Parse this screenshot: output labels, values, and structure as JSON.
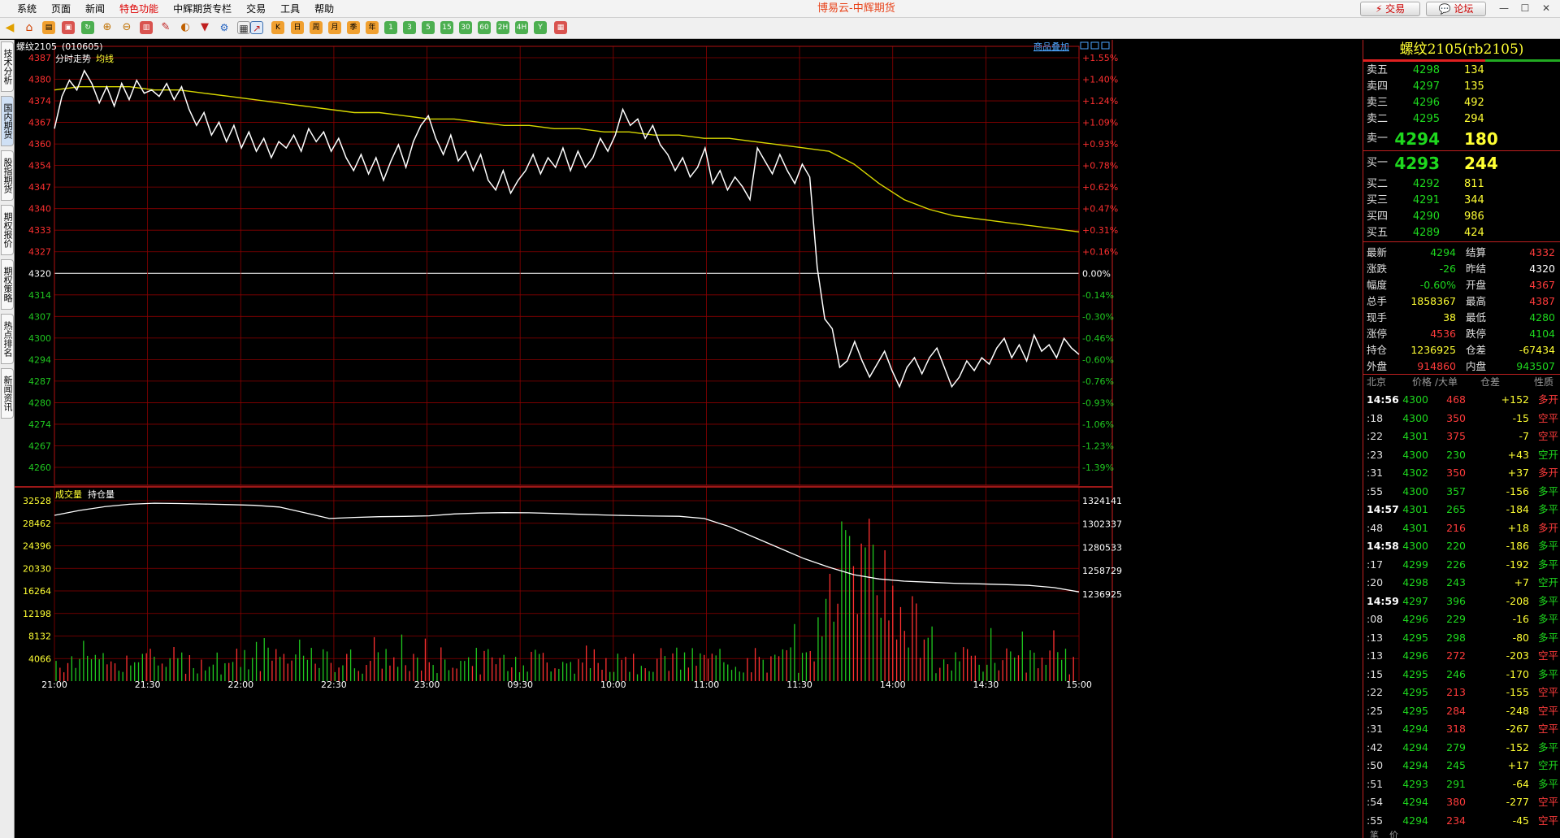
{
  "menu": {
    "items": [
      "系统",
      "页面",
      "新闻",
      "特色功能",
      "中辉期货专栏",
      "交易",
      "工具",
      "帮助"
    ],
    "highlight_index": 3
  },
  "app_title": "博易云-中辉期货",
  "top_buttons": {
    "trade": "交易",
    "forum": "论坛"
  },
  "toolbar": {
    "period_buttons": [
      "日",
      "周",
      "月",
      "季",
      "年",
      "1",
      "3",
      "5",
      "15",
      "30",
      "60",
      "2H",
      "4H",
      "Y"
    ],
    "period_icons": [
      "day-period-icon",
      "week-period-icon",
      "month-period-icon",
      "quarter-period-icon",
      "year-period-icon",
      "1min-icon",
      "3min-icon",
      "5min-icon",
      "15min-icon",
      "30min-icon",
      "60min-icon",
      "2hour-icon",
      "4hour-icon",
      "y-icon"
    ]
  },
  "left_tabs": [
    "技术分析",
    "国内期货",
    "股指期货",
    "期权报价",
    "期权策略",
    "热点排名",
    "新闻资讯"
  ],
  "chart_header": {
    "contract": "螺纹2105",
    "code": "(010605)",
    "tab_trend": "分时走势",
    "tab_avg": "均线",
    "overlay_link": "商品叠加",
    "vol_label": "成交量",
    "oi_label": "持仓量"
  },
  "chart_data": [
    {
      "type": "line",
      "title": "分时走势",
      "ylim": [
        4260,
        4387
      ],
      "y_ticks": [
        4387,
        4380,
        4374,
        4367,
        4360,
        4354,
        4347,
        4340,
        4333,
        4327,
        4320,
        4314,
        4307,
        4300,
        4294,
        4287,
        4280,
        4274,
        4267,
        4260
      ],
      "pct_ticks": [
        "+1.55%",
        "+1.40%",
        "+1.24%",
        "+1.09%",
        "+0.93%",
        "+0.78%",
        "+0.62%",
        "+0.47%",
        "+0.31%",
        "+0.16%",
        "0.00%",
        "-0.14%",
        "-0.30%",
        "-0.46%",
        "-0.60%",
        "-0.76%",
        "-0.93%",
        "-1.06%",
        "-1.23%",
        "-1.39%"
      ],
      "x_ticks": [
        "21:00",
        "21:30",
        "22:00",
        "22:30",
        "23:00",
        "09:30",
        "10:00",
        "11:00",
        "11:30",
        "14:00",
        "14:30",
        "15:00"
      ],
      "series": [
        {
          "name": "分时走势",
          "color": "#ffffff",
          "values": [
            4365,
            4375,
            4380,
            4377,
            4383,
            4379,
            4373,
            4378,
            4372,
            4379,
            4374,
            4380,
            4376,
            4377,
            4375,
            4379,
            4374,
            4378,
            4371,
            4366,
            4370,
            4363,
            4367,
            4361,
            4366,
            4359,
            4364,
            4358,
            4362,
            4356,
            4361,
            4359,
            4363,
            4358,
            4365,
            4361,
            4364,
            4358,
            4362,
            4356,
            4352,
            4357,
            4351,
            4356,
            4349,
            4355,
            4360,
            4353,
            4361,
            4366,
            4369,
            4362,
            4357,
            4363,
            4355,
            4358,
            4352,
            4357,
            4349,
            4346,
            4352,
            4345,
            4349,
            4352,
            4357,
            4351,
            4356,
            4353,
            4359,
            4352,
            4358,
            4353,
            4356,
            4362,
            4358,
            4363,
            4371,
            4366,
            4368,
            4362,
            4366,
            4360,
            4357,
            4352,
            4356,
            4350,
            4353,
            4359,
            4348,
            4352,
            4346,
            4350,
            4347,
            4343,
            4359,
            4355,
            4351,
            4357,
            4352,
            4348,
            4354,
            4350,
            4322,
            4306,
            4303,
            4291,
            4293,
            4299,
            4293,
            4288,
            4292,
            4296,
            4290,
            4285,
            4291,
            4294,
            4289,
            4294,
            4297,
            4291,
            4285,
            4288,
            4293,
            4290,
            4294,
            4292,
            4297,
            4300,
            4294,
            4298,
            4293,
            4301,
            4296,
            4298,
            4294,
            4300,
            4297,
            4295
          ]
        },
        {
          "name": "均线",
          "color": "#d8d800",
          "values": [
            4377,
            4378,
            4378,
            4378,
            4377,
            4377,
            4376,
            4375,
            4374,
            4373,
            4372,
            4371,
            4370,
            4370,
            4369,
            4368,
            4368,
            4367,
            4366,
            4366,
            4365,
            4365,
            4364,
            4364,
            4363,
            4363,
            4362,
            4362,
            4361,
            4360,
            4359,
            4358,
            4354,
            4348,
            4343,
            4340,
            4338,
            4337,
            4336,
            4335,
            4334,
            4333
          ]
        }
      ]
    },
    {
      "type": "bar",
      "title": "成交量",
      "ylim": [
        0,
        32528
      ],
      "y_ticks": [
        32528,
        28462,
        24396,
        20330,
        16264,
        12198,
        8132,
        4066
      ],
      "oi_ticks": [
        1324141,
        1302337,
        1280533,
        1258729,
        1236925
      ],
      "series": [
        {
          "name": "成交量",
          "up_color": "#ff3030",
          "down_color": "#20c820"
        },
        {
          "name": "持仓量",
          "color": "#ffffff",
          "values": [
            1310500,
            1315000,
            1318500,
            1320800,
            1321800,
            1321500,
            1321000,
            1320500,
            1319800,
            1318200,
            1313000,
            1307500,
            1308500,
            1309200,
            1309500,
            1310000,
            1311800,
            1312600,
            1313000,
            1312800,
            1312200,
            1311500,
            1310800,
            1310200,
            1309800,
            1309600,
            1307500,
            1300000,
            1290000,
            1280000,
            1270000,
            1262000,
            1255000,
            1251000,
            1249000,
            1248000,
            1247000,
            1246500,
            1245800,
            1245000,
            1243000,
            1239000
          ]
        }
      ]
    }
  ],
  "quote": {
    "title": "螺纹2105(rb2105)",
    "asks": [
      {
        "label": "卖五",
        "price": "4298",
        "vol": "134"
      },
      {
        "label": "卖四",
        "price": "4297",
        "vol": "135"
      },
      {
        "label": "卖三",
        "price": "4296",
        "vol": "492"
      },
      {
        "label": "卖二",
        "price": "4295",
        "vol": "294"
      },
      {
        "label": "卖一",
        "price": "4294",
        "vol": "180"
      }
    ],
    "bids": [
      {
        "label": "买一",
        "price": "4293",
        "vol": "244"
      },
      {
        "label": "买二",
        "price": "4292",
        "vol": "811"
      },
      {
        "label": "买三",
        "price": "4291",
        "vol": "344"
      },
      {
        "label": "买四",
        "price": "4290",
        "vol": "986"
      },
      {
        "label": "买五",
        "price": "4289",
        "vol": "424"
      }
    ],
    "stats": [
      {
        "l1": "最新",
        "v1": "4294",
        "c1": "green",
        "l2": "结算",
        "v2": "4332",
        "c2": "red"
      },
      {
        "l1": "涨跌",
        "v1": "-26",
        "c1": "green",
        "l2": "昨结",
        "v2": "4320",
        "c2": "white"
      },
      {
        "l1": "幅度",
        "v1": "-0.60%",
        "c1": "green",
        "l2": "开盘",
        "v2": "4367",
        "c2": "red"
      },
      {
        "l1": "总手",
        "v1": "1858367",
        "c1": "yellow",
        "l2": "最高",
        "v2": "4387",
        "c2": "red"
      },
      {
        "l1": "现手",
        "v1": "38",
        "c1": "yellow",
        "l2": "最低",
        "v2": "4280",
        "c2": "green"
      },
      {
        "l1": "涨停",
        "v1": "4536",
        "c1": "red",
        "l2": "跌停",
        "v2": "4104",
        "c2": "green"
      },
      {
        "l1": "持仓",
        "v1": "1236925",
        "c1": "yellow",
        "l2": "仓差",
        "v2": "-67434",
        "c2": "yellow"
      },
      {
        "l1": "外盘",
        "v1": "914860",
        "c1": "red",
        "l2": "内盘",
        "v2": "943507",
        "c2": "green"
      }
    ],
    "tick_header": {
      "time": "北京",
      "price": "价格",
      "vol": "∕大单",
      "oi": "仓差",
      "nature": "性质"
    },
    "ticks": [
      {
        "t": "14:56",
        "p": "4300",
        "pc": "green",
        "v": "468",
        "vc": "red",
        "d": "+152",
        "n": "多开",
        "nc": "red",
        "full": true
      },
      {
        "t": ":18",
        "p": "4300",
        "pc": "green",
        "v": "350",
        "vc": "red",
        "d": "-15",
        "n": "空平",
        "nc": "red",
        "full": false
      },
      {
        "t": ":22",
        "p": "4301",
        "pc": "green",
        "v": "375",
        "vc": "red",
        "d": "-7",
        "n": "空平",
        "nc": "red",
        "full": false
      },
      {
        "t": ":23",
        "p": "4300",
        "pc": "green",
        "v": "230",
        "vc": "green",
        "d": "+43",
        "n": "空开",
        "nc": "green",
        "full": false
      },
      {
        "t": ":31",
        "p": "4302",
        "pc": "green",
        "v": "350",
        "vc": "red",
        "d": "+37",
        "n": "多开",
        "nc": "red",
        "full": false
      },
      {
        "t": ":55",
        "p": "4300",
        "pc": "green",
        "v": "357",
        "vc": "green",
        "d": "-156",
        "n": "多平",
        "nc": "green",
        "full": false
      },
      {
        "t": "14:57",
        "p": "4301",
        "pc": "green",
        "v": "265",
        "vc": "green",
        "d": "-184",
        "n": "多平",
        "nc": "green",
        "full": true
      },
      {
        "t": ":48",
        "p": "4301",
        "pc": "green",
        "v": "216",
        "vc": "red",
        "d": "+18",
        "n": "多开",
        "nc": "red",
        "full": false
      },
      {
        "t": "14:58",
        "p": "4300",
        "pc": "green",
        "v": "220",
        "vc": "green",
        "d": "-186",
        "n": "多平",
        "nc": "green",
        "full": true
      },
      {
        "t": ":17",
        "p": "4299",
        "pc": "green",
        "v": "226",
        "vc": "green",
        "d": "-192",
        "n": "多平",
        "nc": "green",
        "full": false
      },
      {
        "t": ":20",
        "p": "4298",
        "pc": "green",
        "v": "243",
        "vc": "green",
        "d": "+7",
        "n": "空开",
        "nc": "green",
        "full": false
      },
      {
        "t": "14:59",
        "p": "4297",
        "pc": "green",
        "v": "396",
        "vc": "green",
        "d": "-208",
        "n": "多平",
        "nc": "green",
        "full": true
      },
      {
        "t": ":08",
        "p": "4296",
        "pc": "green",
        "v": "229",
        "vc": "green",
        "d": "-16",
        "n": "多平",
        "nc": "green",
        "full": false
      },
      {
        "t": ":13",
        "p": "4295",
        "pc": "green",
        "v": "298",
        "vc": "green",
        "d": "-80",
        "n": "多平",
        "nc": "green",
        "full": false
      },
      {
        "t": ":13",
        "p": "4296",
        "pc": "green",
        "v": "272",
        "vc": "red",
        "d": "-203",
        "n": "空平",
        "nc": "red",
        "full": false
      },
      {
        "t": ":15",
        "p": "4295",
        "pc": "green",
        "v": "246",
        "vc": "green",
        "d": "-170",
        "n": "多平",
        "nc": "green",
        "full": false
      },
      {
        "t": ":22",
        "p": "4295",
        "pc": "green",
        "v": "213",
        "vc": "red",
        "d": "-155",
        "n": "空平",
        "nc": "red",
        "full": false
      },
      {
        "t": ":25",
        "p": "4295",
        "pc": "green",
        "v": "284",
        "vc": "red",
        "d": "-248",
        "n": "空平",
        "nc": "red",
        "full": false
      },
      {
        "t": ":31",
        "p": "4294",
        "pc": "green",
        "v": "318",
        "vc": "red",
        "d": "-267",
        "n": "空平",
        "nc": "red",
        "full": false
      },
      {
        "t": ":42",
        "p": "4294",
        "pc": "green",
        "v": "279",
        "vc": "green",
        "d": "-152",
        "n": "多平",
        "nc": "green",
        "full": false
      },
      {
        "t": ":50",
        "p": "4294",
        "pc": "green",
        "v": "245",
        "vc": "green",
        "d": "+17",
        "n": "空开",
        "nc": "green",
        "full": false
      },
      {
        "t": ":51",
        "p": "4293",
        "pc": "green",
        "v": "291",
        "vc": "green",
        "d": "-64",
        "n": "多平",
        "nc": "green",
        "full": false
      },
      {
        "t": ":54",
        "p": "4294",
        "pc": "green",
        "v": "380",
        "vc": "red",
        "d": "-277",
        "n": "空平",
        "nc": "red",
        "full": false
      },
      {
        "t": ":55",
        "p": "4294",
        "pc": "green",
        "v": "234",
        "vc": "red",
        "d": "-45",
        "n": "空平",
        "nc": "red",
        "full": false
      }
    ],
    "bottom_tabs": [
      "笔",
      "价"
    ]
  },
  "colors": {
    "up": "#ff3030",
    "down": "#20c820",
    "grid": "#8b0000",
    "zero": "#ffffff"
  }
}
